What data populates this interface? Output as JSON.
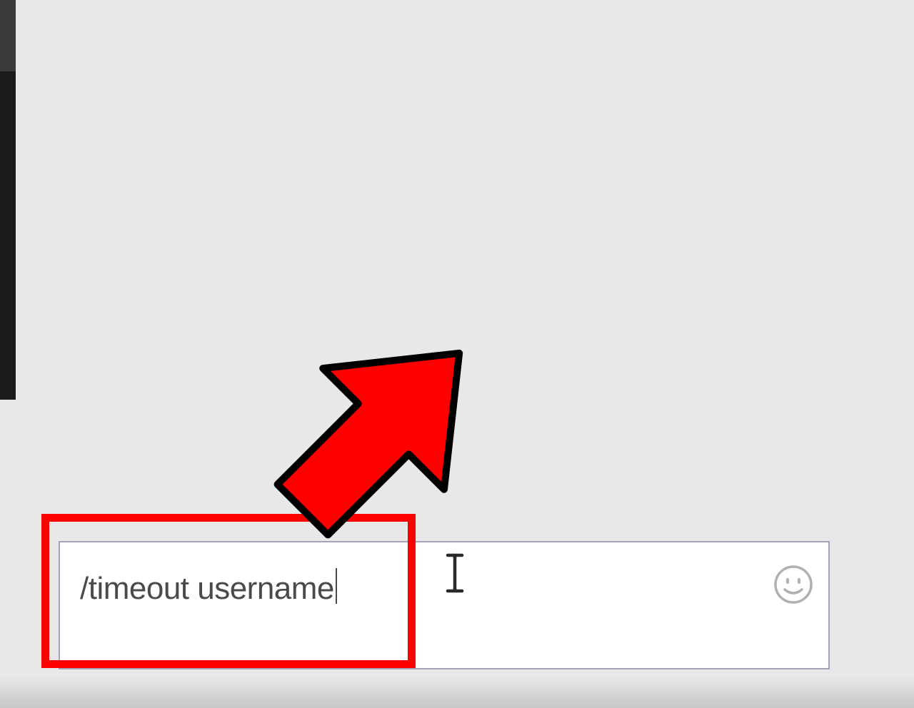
{
  "chat": {
    "input_value": "/timeout username",
    "emoji_icon_name": "emoji-icon"
  },
  "annotation": {
    "arrow_color": "#ff0000",
    "highlight_color": "#ff0000"
  }
}
